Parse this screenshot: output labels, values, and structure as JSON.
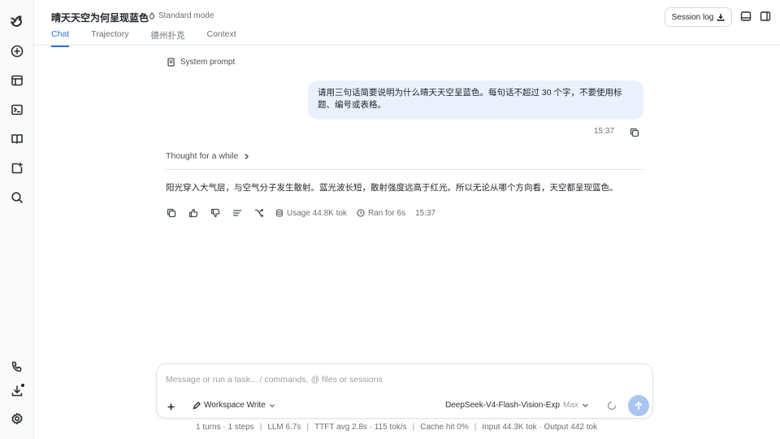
{
  "header": {
    "title": "晴天天空为何呈现蓝色",
    "mode": "Standard mode",
    "session_log_label": "Session log"
  },
  "tabs": [
    {
      "label": "Chat",
      "active": true
    },
    {
      "label": "Trajectory",
      "active": false
    },
    {
      "label": "德州扑克",
      "active": false
    },
    {
      "label": "Context",
      "active": false
    }
  ],
  "sidebar": {
    "icons": [
      "logo-icon",
      "new-chat-icon",
      "layout-icon",
      "terminal-icon",
      "book-icon",
      "add-image-icon",
      "search-icon",
      "phone-icon",
      "download-icon",
      "settings-icon"
    ]
  },
  "conversation": {
    "system_prompt_label": "System prompt",
    "user_message": "请用三句话简要说明为什么晴天天空呈蓝色。每句话不超过 30 个字，不要使用标题、编号或表格。",
    "user_time": "15:37",
    "thought_label": "Thought for a while",
    "answer": "阳光穿入大气层，与空气分子发生散射。蓝光波长短，散射强度远高于红光。所以无论从哪个方向看，天空都呈现蓝色。",
    "usage": "Usage 44.8K tok",
    "ran_for": "Ran for 6s",
    "answer_time": "15:37"
  },
  "composer": {
    "placeholder": "Message or run a task... / commands, @ files or sessions",
    "value": "",
    "workspace_mode": "Workspace Write",
    "model": "DeepSeek-V4-Flash-Vision-Exp",
    "model_level": "Max"
  },
  "status": {
    "turns": "1 turns · 1 steps",
    "llm": "LLM 6.7s",
    "ttft": "TTFT avg 2.8s · 115 tok/s",
    "cache": "Cache hit 0%",
    "tokens": "Input 44.3K tok · Output 442 tok"
  },
  "colors": {
    "accent": "#2f6fd6",
    "user_bubble": "#eaf1fc",
    "send_button": "#a9c6f2"
  }
}
